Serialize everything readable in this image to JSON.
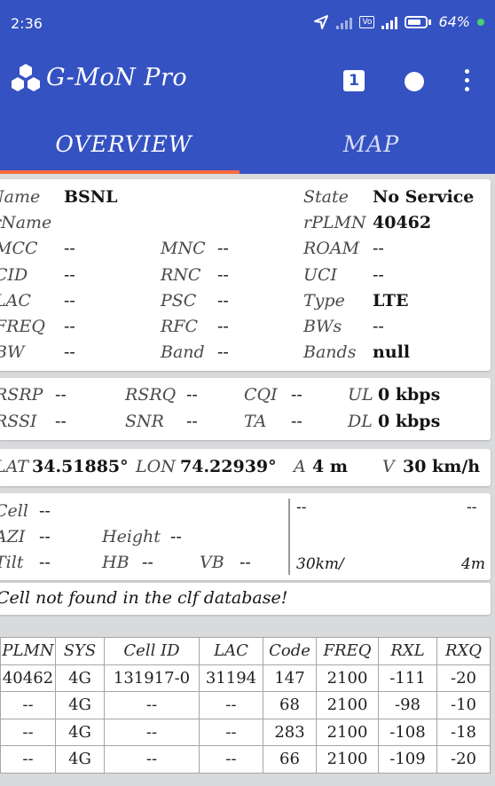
{
  "status_bar": {
    "time": "2:36",
    "battery": "64%"
  },
  "app": {
    "title": "G-MoN Pro",
    "counter": "1"
  },
  "tabs": [
    {
      "label": "OVERVIEW"
    },
    {
      "label": "MAP"
    }
  ],
  "serving": {
    "name_label": "Name",
    "name_value": "BSNL",
    "rname_label": "rName",
    "rname_value": "",
    "mcc_label": "MCC",
    "mcc_value": "--",
    "cid_label": "CID",
    "cid_value": "--",
    "lac_label": "LAC",
    "lac_value": "--",
    "freq_label": "FREQ",
    "freq_value": "--",
    "bw_label": "BW",
    "bw_value": "--",
    "mnc_label": "MNC",
    "mnc_value": "--",
    "rnc_label": "RNC",
    "rnc_value": "--",
    "psc_label": "PSC",
    "psc_value": "--",
    "rfc_label": "RFC",
    "rfc_value": "--",
    "band_label": "Band",
    "band_value": "--",
    "state_label": "State",
    "state_value": "No Service",
    "rplmn_label": "rPLMN",
    "rplmn_value": "40462",
    "roam_label": "ROAM",
    "roam_value": "--",
    "uci_label": "UCI",
    "uci_value": "--",
    "type_label": "Type",
    "type_value": "LTE",
    "bws_label": "BWs",
    "bws_value": "--",
    "bands_label": "Bands",
    "bands_value": "null"
  },
  "signal": {
    "rsrp_label": "RSRP",
    "rsrp_value": "--",
    "rssi_label": "RSSI",
    "rssi_value": "--",
    "rsrq_label": "RSRQ",
    "rsrq_value": "--",
    "snr_label": "SNR",
    "snr_value": "--",
    "cqi_label": "CQI",
    "cqi_value": "--",
    "ta_label": "TA",
    "ta_value": "--",
    "ul_label": "UL",
    "ul_value": "0 kbps",
    "dl_label": "DL",
    "dl_value": "0 kbps"
  },
  "location": {
    "lat_label": "LAT",
    "lat_value": "34.51885°",
    "lon_label": "LON",
    "lon_value": "74.22939°",
    "acc_label": "A",
    "acc_value": "4 m",
    "vel_label": "V",
    "vel_value": "30 km/h"
  },
  "cell_info": {
    "cell_label": "Cell",
    "cell_value": "--",
    "azi_label": "AZI",
    "azi_value": "--",
    "tilt_label": "Tilt",
    "tilt_value": "--",
    "height_label": "Height",
    "height_value": "--",
    "hb_label": "HB",
    "hb_value": "--",
    "vb_label": "VB",
    "vb_value": "--",
    "dist_left": "--",
    "dist_right": "--",
    "dist_scale_left": "30km/",
    "dist_scale_right": "4m"
  },
  "message": "Cell not found in the clf database!",
  "neighbors": {
    "headers": [
      "PLMN",
      "SYS",
      "Cell ID",
      "LAC",
      "Code",
      "FREQ",
      "RXL",
      "RXQ"
    ],
    "rows": [
      [
        "40462",
        "4G",
        "131917-0",
        "31194",
        "147",
        "2100",
        "-111",
        "-20"
      ],
      [
        "--",
        "4G",
        "--",
        "--",
        "68",
        "2100",
        "-98",
        "-10"
      ],
      [
        "--",
        "4G",
        "--",
        "--",
        "283",
        "2100",
        "-108",
        "-18"
      ],
      [
        "--",
        "4G",
        "--",
        "--",
        "66",
        "2100",
        "-109",
        "-20"
      ]
    ]
  }
}
